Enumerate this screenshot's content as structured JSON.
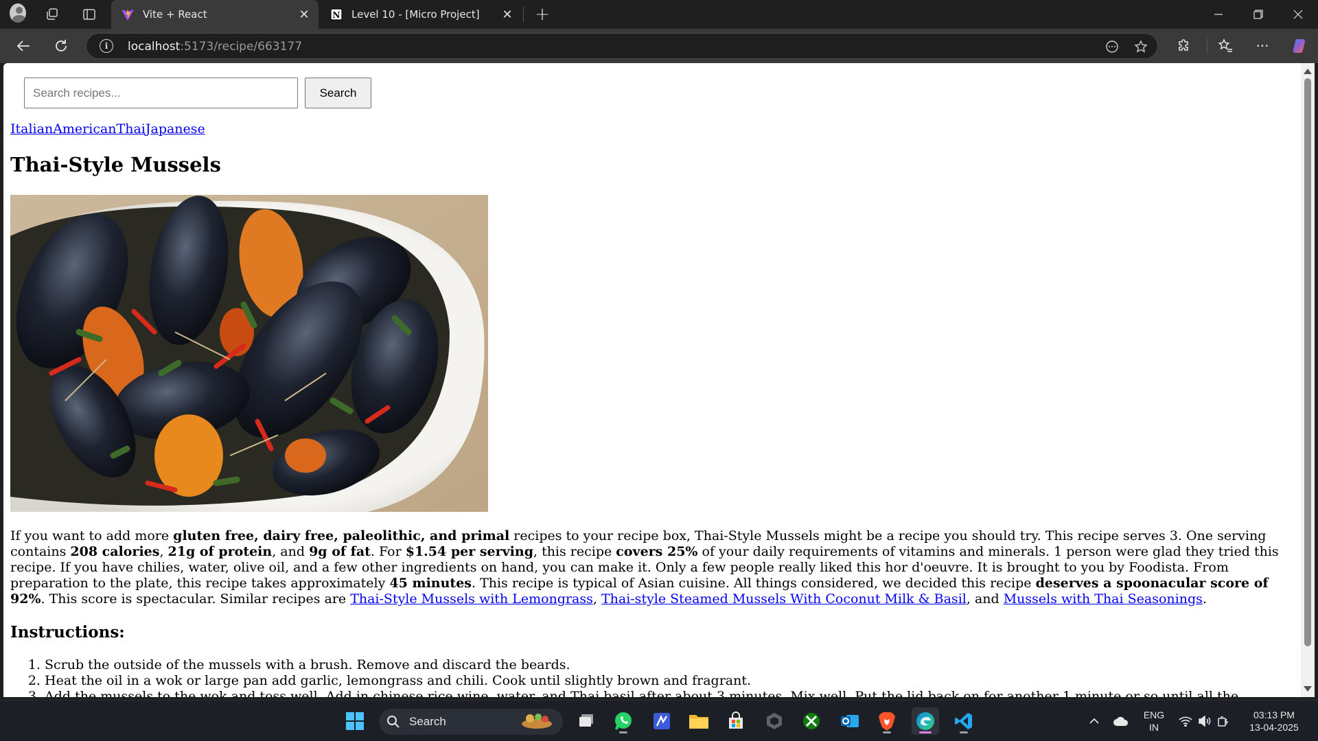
{
  "browser": {
    "tabs": [
      {
        "title": "Vite + React",
        "active": true
      },
      {
        "title": "Level 10 - [Micro Project]",
        "active": false
      }
    ],
    "url_host": "localhost",
    "url_path": ":5173/recipe/663177",
    "accent_color": "#1f1f1f"
  },
  "page": {
    "search": {
      "placeholder": "Search recipes...",
      "value": "",
      "button_label": "Search"
    },
    "cuisines": [
      "Italian",
      "American",
      "Thai",
      "Japanese"
    ],
    "recipe_title": "Thai-Style Mussels",
    "summary": {
      "t1": "If you want to add more ",
      "b1": "gluten free, dairy free, paleolithic, and primal",
      "t2": " recipes to your recipe box, Thai-Style Mussels might be a recipe you should try. This recipe serves 3. One serving contains ",
      "b2": "208 calories",
      "t3": ", ",
      "b3": "21g of protein",
      "t4": ", and ",
      "b4": "9g of fat",
      "t5": ". For ",
      "b5": "$1.54 per serving",
      "t6": ", this recipe ",
      "b6": "covers 25%",
      "t7": " of your daily requirements of vitamins and minerals. 1 person were glad they tried this recipe. If you have chilies, water, olive oil, and a few other ingredients on hand, you can make it. Only a few people really liked this hor d'oeuvre. It is brought to you by Foodista. From preparation to the plate, this recipe takes approximately ",
      "b7": "45 minutes",
      "t8": ". This recipe is typical of Asian cuisine. All things considered, we decided this recipe ",
      "b8": "deserves a spoonacular score of 92%",
      "t9": ". This score is spectacular. Similar recipes are ",
      "l1": "Thai-Style Mussels with Lemongrass",
      "t10": ", ",
      "l2": "Thai-style Steamed Mussels With Coconut Milk & Basil",
      "t11": ", and ",
      "l3": "Mussels with Thai Seasonings",
      "t12": "."
    },
    "instructions_heading": "Instructions:",
    "instructions": [
      "Scrub the outside of the mussels with a brush. Remove and discard the beards.",
      "Heat the oil in a wok or large pan add garlic, lemongrass and chili. Cook until slightly brown and fragrant.",
      "Add the mussels to the wok and toss well. Add in chinese rice wine, water, and Thai basil after about 3 minutes. Mix well. Put the lid back on for another 1 minute or so until all the mussels are open (discard any that stay closed)."
    ]
  },
  "taskbar": {
    "search_label": "Search",
    "language": "ENG",
    "region": "IN",
    "time": "03:13 PM",
    "date": "13-04-2025"
  }
}
